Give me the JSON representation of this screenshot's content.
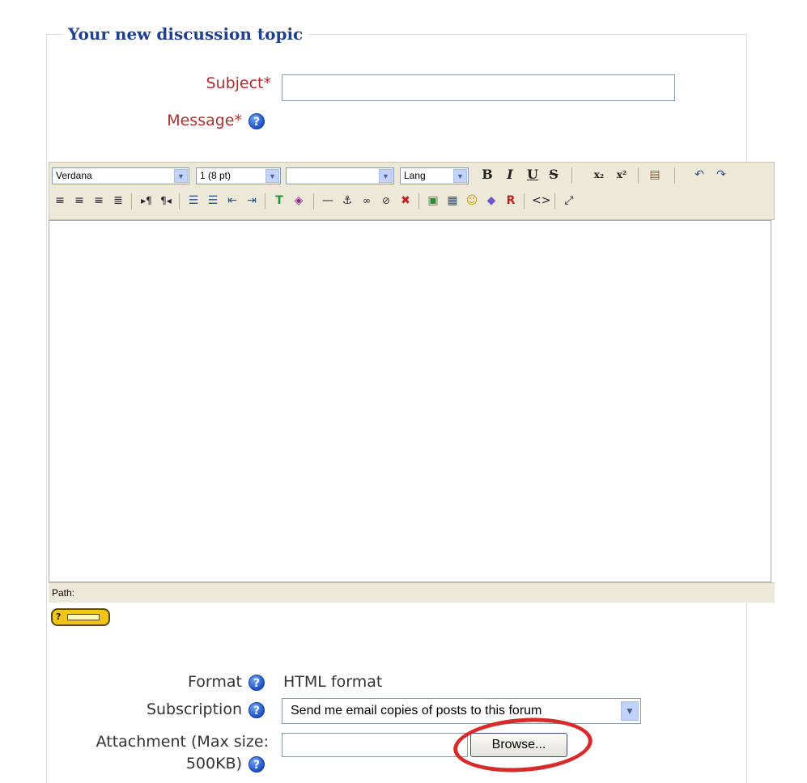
{
  "form": {
    "legend": "Your new discussion topic",
    "subject_label": "Subject*",
    "message_label": "Message*",
    "subject_value": "",
    "format_label": "Format",
    "format_value": "HTML format",
    "subscription_label": "Subscription",
    "subscription_value": "Send me email copies of posts to this forum",
    "attachment_label_line1": "Attachment (Max size:",
    "attachment_label_line2": "500KB)",
    "attachment_value": "",
    "browse_label": "Browse..."
  },
  "help_icon_glyph": "?",
  "editor": {
    "font_select": "Verdana",
    "size_select": "1 (8 pt)",
    "style_select": "",
    "lang_select": "Lang",
    "bold": "B",
    "italic": "I",
    "underline": "U",
    "strike": "S",
    "subscript": "x₂",
    "superscript": "x²",
    "path_label": "Path:",
    "keyboard_help_label": "?"
  },
  "colors": {
    "legend": "#1f3f8f",
    "required_label": "#b22d30",
    "toolbar_bg": "#ece9d8",
    "highlight_circle": "#d72a2a"
  }
}
